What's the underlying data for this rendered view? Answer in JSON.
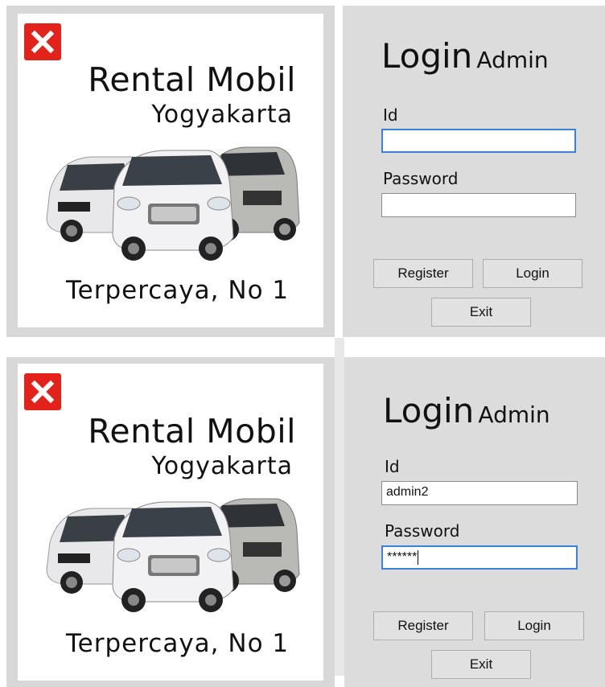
{
  "screens": [
    {
      "brand": {
        "title": "Rental Mobil",
        "subtitle": "Yogyakarta",
        "tagline": "Terpercaya, No 1"
      },
      "login": {
        "title_main": "Login",
        "title_sub": "Admin",
        "id_label": "Id",
        "id_value": "",
        "password_label": "Password",
        "password_value": "",
        "register_label": "Register",
        "login_label": "Login",
        "exit_label": "Exit"
      }
    },
    {
      "brand": {
        "title": "Rental Mobil",
        "subtitle": "Yogyakarta",
        "tagline": "Terpercaya, No 1"
      },
      "login": {
        "title_main": "Login",
        "title_sub": "Admin",
        "id_label": "Id",
        "id_value": "admin2",
        "password_label": "Password",
        "password_value": "******",
        "register_label": "Register",
        "login_label": "Login",
        "exit_label": "Exit"
      }
    }
  ],
  "colors": {
    "close": "#e3221c",
    "focus": "#3a82d6",
    "panel": "#dcdcdc"
  },
  "icons": {
    "close": "close-icon"
  }
}
